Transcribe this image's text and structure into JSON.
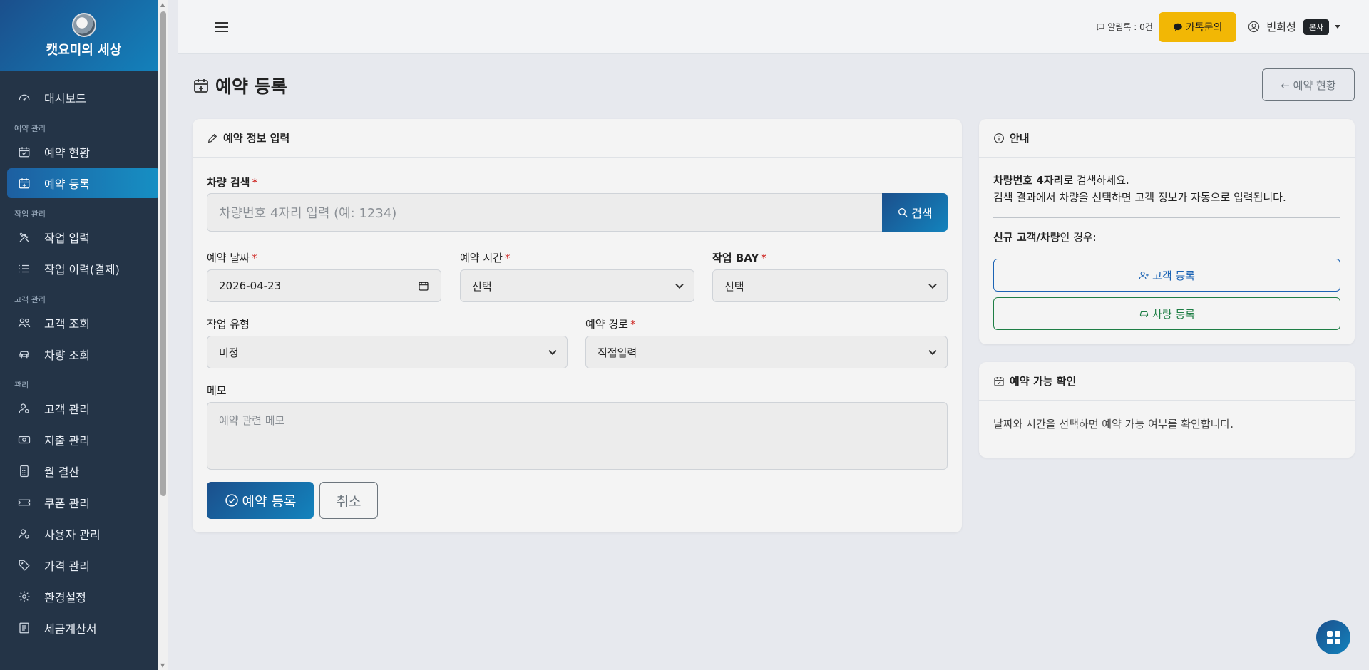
{
  "brand": {
    "name": "캣요미의 세상"
  },
  "sidebar": {
    "items": [
      {
        "label": "대시보드",
        "icon": "speedometer-icon"
      },
      {
        "section": "예약 관리"
      },
      {
        "label": "예약 현황",
        "icon": "calendar-check-icon"
      },
      {
        "label": "예약 등록",
        "icon": "calendar-plus-icon",
        "active": true
      },
      {
        "section": "작업 관리"
      },
      {
        "label": "작업 입력",
        "icon": "tools-icon"
      },
      {
        "label": "작업 이력(결제)",
        "icon": "list-icon"
      },
      {
        "section": "고객 관리"
      },
      {
        "label": "고객 조회",
        "icon": "people-icon"
      },
      {
        "label": "차량 조회",
        "icon": "car-icon"
      },
      {
        "section": "관리"
      },
      {
        "label": "고객 관리",
        "icon": "person-gear-icon"
      },
      {
        "label": "지출 관리",
        "icon": "cash-icon"
      },
      {
        "label": "월 결산",
        "icon": "calculator-icon"
      },
      {
        "label": "쿠폰 관리",
        "icon": "ticket-icon"
      },
      {
        "label": "사용자 관리",
        "icon": "person-gear-icon"
      },
      {
        "label": "가격 관리",
        "icon": "tags-icon"
      },
      {
        "label": "환경설정",
        "icon": "gear-icon"
      },
      {
        "label": "세금계산서",
        "icon": "receipt-icon"
      }
    ]
  },
  "topbar": {
    "alimtalk": "알림톡 : 0건",
    "kakao_label": "카톡문의",
    "user_name": "변희성",
    "user_badge": "본사"
  },
  "page": {
    "title": "예약 등록",
    "back_label": "← 예약 현황"
  },
  "form": {
    "header": "예약 정보 입력",
    "vehicle_search_label": "차량 검색",
    "vehicle_search_placeholder": "차량번호 4자리 입력 (예: 1234)",
    "search_button": "검색",
    "date_label": "예약 날짜",
    "date_value": "2026-04-23",
    "time_label": "예약 시간",
    "time_value": "선택",
    "bay_label": "작업 BAY",
    "bay_value": "선택",
    "work_type_label": "작업 유형",
    "work_type_value": "미정",
    "route_label": "예약 경로",
    "route_value": "직접입력",
    "memo_label": "메모",
    "memo_placeholder": "예약 관련 메모",
    "submit_label": "예약 등록",
    "cancel_label": "취소",
    "required_mark": "*"
  },
  "info": {
    "header": "안내",
    "line1_bold": "차량번호 4자리",
    "line1_rest": "로 검색하세요.",
    "line2": "검색 결과에서 차량을 선택하면 고객 정보가 자동으로 입력됩니다.",
    "new_bold": "신규 고객/차량",
    "new_rest": "인 경우:",
    "customer_button": "고객 등록",
    "vehicle_button": "차량 등록"
  },
  "availability": {
    "header": "예약 가능 확인",
    "text": "날짜와 시간을 선택하면 예약 가능 여부를 확인합니다."
  },
  "colors": {
    "sidebar_bg": "#243447",
    "accent_gradient_start": "#1b4f8c",
    "accent_gradient_end": "#1383bd",
    "kakao_yellow": "#f2b705",
    "required_red": "#d0312d"
  }
}
